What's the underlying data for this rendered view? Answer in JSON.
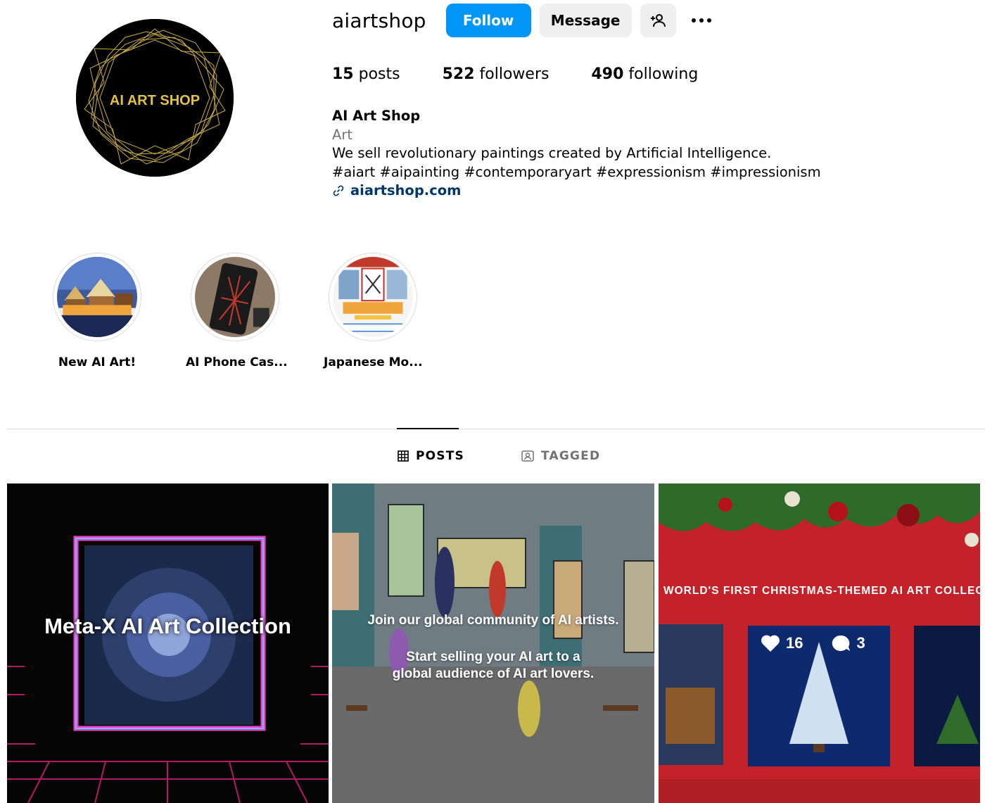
{
  "profile": {
    "username": "aiartshop",
    "avatar_text": "AI ART SHOP",
    "follow_label": "Follow",
    "message_label": "Message",
    "add_user_icon": "person-add-icon",
    "more_icon": "more-dots-icon"
  },
  "stats": {
    "posts_count": "15",
    "posts_label": "posts",
    "followers_count": "522",
    "followers_label": "followers",
    "following_count": "490",
    "following_label": "following"
  },
  "bio": {
    "full_name": "AI Art Shop",
    "category": "Art",
    "line1": "We sell revolutionary paintings created by Artificial Intelligence.",
    "line2": "#aiart #aipainting #contemporaryart #expressionism #impressionism",
    "link_icon": "link-icon",
    "link": "aiartshop.com"
  },
  "highlights": [
    {
      "label": "New AI Art!"
    },
    {
      "label": "AI Phone Cas..."
    },
    {
      "label": "Japanese Mo..."
    }
  ],
  "tabs": [
    {
      "label": "POSTS",
      "icon": "grid-icon",
      "active": true
    },
    {
      "label": "TAGGED",
      "icon": "tagged-icon",
      "active": false
    }
  ],
  "posts": [
    {
      "text": "Meta-X AI Art Collection"
    },
    {
      "text1": "Join our global community of AI artists.",
      "text2a": "Start selling your AI art to a",
      "text2b": "global audience of AI art lovers."
    },
    {
      "banner": "WORLD'S FIRST CHRISTMAS-THEMED AI ART COLLECT",
      "likes": "16",
      "comments": "3"
    }
  ],
  "colors": {
    "accent": "#0095f6",
    "link": "#00376b",
    "secondary_text": "#737373",
    "button_bg": "#efefef"
  }
}
